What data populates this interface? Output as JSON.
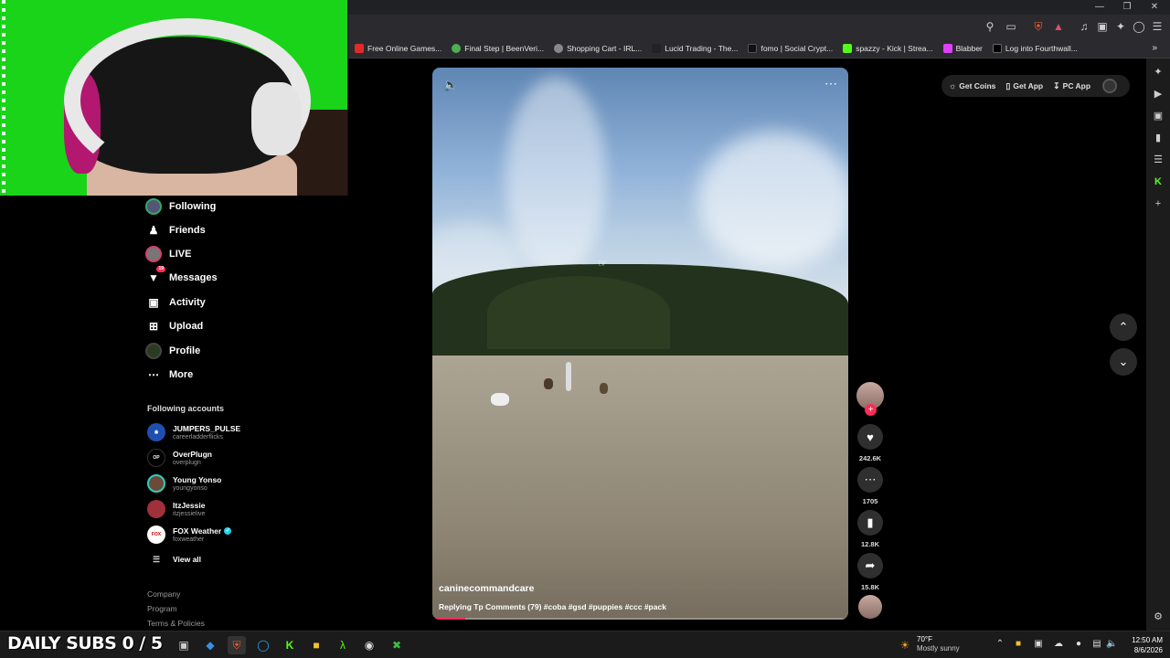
{
  "bookmarks": [
    {
      "label": "Free Online Games...",
      "color": "#e02a2a"
    },
    {
      "label": "Final Step | BeenVeri...",
      "color": "#4caf50"
    },
    {
      "label": "Shopping Cart - IRL...",
      "color": "#888888"
    },
    {
      "label": "Lucid Trading - The...",
      "color": "#222222"
    },
    {
      "label": "fomo | Social Crypt...",
      "color": "#111111"
    },
    {
      "label": "spazzy - Kick | Strea...",
      "color": "#53fc18"
    },
    {
      "label": "Blabber",
      "color": "#e040fb"
    },
    {
      "label": "Log into Fourthwall...",
      "color": "#000000"
    }
  ],
  "nav": {
    "following": "Following",
    "friends": "Friends",
    "live": "LIVE",
    "messages": "Messages",
    "messages_badge": "19",
    "activity": "Activity",
    "upload": "Upload",
    "profile": "Profile",
    "more": "More"
  },
  "following_accounts": {
    "title": "Following accounts",
    "accounts": [
      {
        "name": "JUMPERS_PULSE",
        "handle": "careerladderflicks"
      },
      {
        "name": "OverPlugn",
        "handle": "overplugn"
      },
      {
        "name": "Young Yonso",
        "handle": "youngyonso"
      },
      {
        "name": "ItzJessie",
        "handle": "itzjessielive"
      },
      {
        "name": "FOX Weather",
        "handle": "foxweather"
      }
    ],
    "view_all": "View all"
  },
  "footer": {
    "company": "Company",
    "program": "Program",
    "terms": "Terms & Policies"
  },
  "video": {
    "username": "caninecommandcare",
    "description": "Replying Tp Comments (79) #coba #gsd #puppies #ccc #pack",
    "progress": 0.08
  },
  "actions": {
    "likes": "242.6K",
    "comments": "1705",
    "saves": "12.8K",
    "shares": "15.8K"
  },
  "top_right": {
    "get_coins": "Get Coins",
    "get_app": "Get App",
    "pc_app": "PC App"
  },
  "taskbar": {
    "subs_label": "DAILY SUBS 0 / 5",
    "weather_temp": "70°F",
    "weather_desc": "Mostly sunny",
    "time": "12:50 AM",
    "date": "8/6/2026"
  },
  "colors": {
    "accent": "#fe2c55",
    "green_screen": "#19d419"
  }
}
